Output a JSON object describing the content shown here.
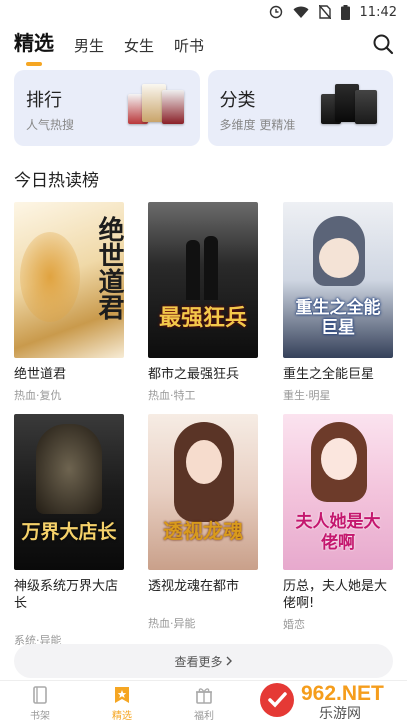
{
  "status_bar": {
    "time": "11:42"
  },
  "nav": {
    "tabs": [
      {
        "label": "精选"
      },
      {
        "label": "男生"
      },
      {
        "label": "女生"
      },
      {
        "label": "听书"
      }
    ]
  },
  "entry_cards": [
    {
      "title": "排行",
      "subtitle": "人气热搜"
    },
    {
      "title": "分类",
      "subtitle": "多维度 更精准"
    }
  ],
  "section": {
    "title": "今日热读榜"
  },
  "books": [
    {
      "title": "绝世道君",
      "tags": "热血·复仇",
      "cover_text": "绝世道君"
    },
    {
      "title": "都市之最强狂兵",
      "tags": "热血·特工",
      "cover_text": "最强狂兵"
    },
    {
      "title": "重生之全能巨星",
      "tags": "重生·明星",
      "cover_text": "重生之全能巨星"
    },
    {
      "title": "神级系统万界大店长",
      "tags": "系统·异能",
      "cover_text": "万界大店长"
    },
    {
      "title": "透视龙魂在都市",
      "tags": "热血·异能",
      "cover_text": "透视龙魂"
    },
    {
      "title": "历总，夫人她是大佬啊!",
      "tags": "婚恋",
      "cover_text": "夫人她是大佬啊"
    }
  ],
  "more_button": {
    "label": "查看更多"
  },
  "bottom_nav": [
    {
      "label": "书架"
    },
    {
      "label": "精选"
    },
    {
      "label": "福利"
    }
  ],
  "watermark": {
    "text": "962.NET",
    "subtext": "乐游网"
  },
  "colors": {
    "accent": "#f5a623",
    "card_bg": "#e9edf9"
  }
}
